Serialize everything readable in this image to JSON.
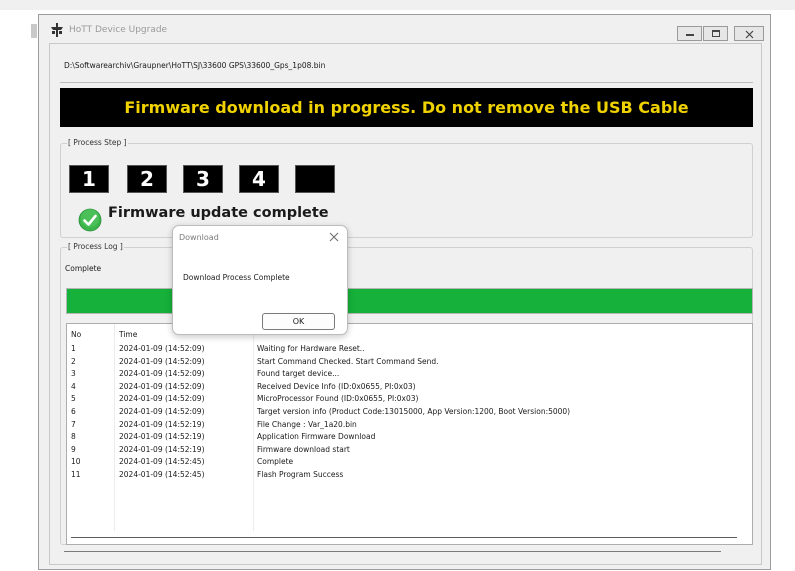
{
  "window": {
    "title": "HoTT Device Upgrade",
    "icon": "hott-connector-icon"
  },
  "file_path": "D:\\Softwarearchiv\\Graupner\\HoTT\\SJ\\33600 GPS\\33600_Gps_1p08.bin",
  "warning_banner": "Firmware download in progress. Do not remove the USB Cable",
  "process_step": {
    "legend": "[ Process Step ]",
    "steps": [
      "1",
      "2",
      "3",
      "4",
      ""
    ],
    "status_icon": "check-circle-icon",
    "status_text": "Firmware update complete"
  },
  "process_log": {
    "legend": "[ Process Log ]",
    "status": "Complete",
    "progress_percent": 100,
    "progress_color": "#16b13a",
    "columns": [
      "No",
      "Time",
      ""
    ],
    "rows": [
      {
        "no": "1",
        "time": "2024-01-09 (14:52:09)",
        "message": "Waiting for Hardware Reset.."
      },
      {
        "no": "2",
        "time": "2024-01-09 (14:52:09)",
        "message": "Start Command Checked. Start Command Send."
      },
      {
        "no": "3",
        "time": "2024-01-09 (14:52:09)",
        "message": "Found target device..."
      },
      {
        "no": "4",
        "time": "2024-01-09 (14:52:09)",
        "message": "Received Device Info (ID:0x0655, PI:0x03)"
      },
      {
        "no": "5",
        "time": "2024-01-09 (14:52:09)",
        "message": "MicroProcessor Found (ID:0x0655, PI:0x03)"
      },
      {
        "no": "6",
        "time": "2024-01-09 (14:52:09)",
        "message": "Target version info (Product Code:13015000, App Version:1200, Boot Version:5000)"
      },
      {
        "no": "7",
        "time": "2024-01-09 (14:52:19)",
        "message": "File Change : Var_1a20.bin"
      },
      {
        "no": "8",
        "time": "2024-01-09 (14:52:19)",
        "message": "Application Firmware Download"
      },
      {
        "no": "9",
        "time": "2024-01-09 (14:52:19)",
        "message": "Firmware download start"
      },
      {
        "no": "10",
        "time": "2024-01-09 (14:52:45)",
        "message": "Complete"
      },
      {
        "no": "11",
        "time": "2024-01-09 (14:52:45)",
        "message": "Flash Program Success"
      }
    ]
  },
  "dialog": {
    "title": "Download",
    "message": "Download Process Complete",
    "ok_label": "OK"
  },
  "colors": {
    "banner_text": "#f0d200",
    "banner_background": "#000000",
    "progress_fill": "#16b13a",
    "check_icon": "#3bb54a"
  }
}
